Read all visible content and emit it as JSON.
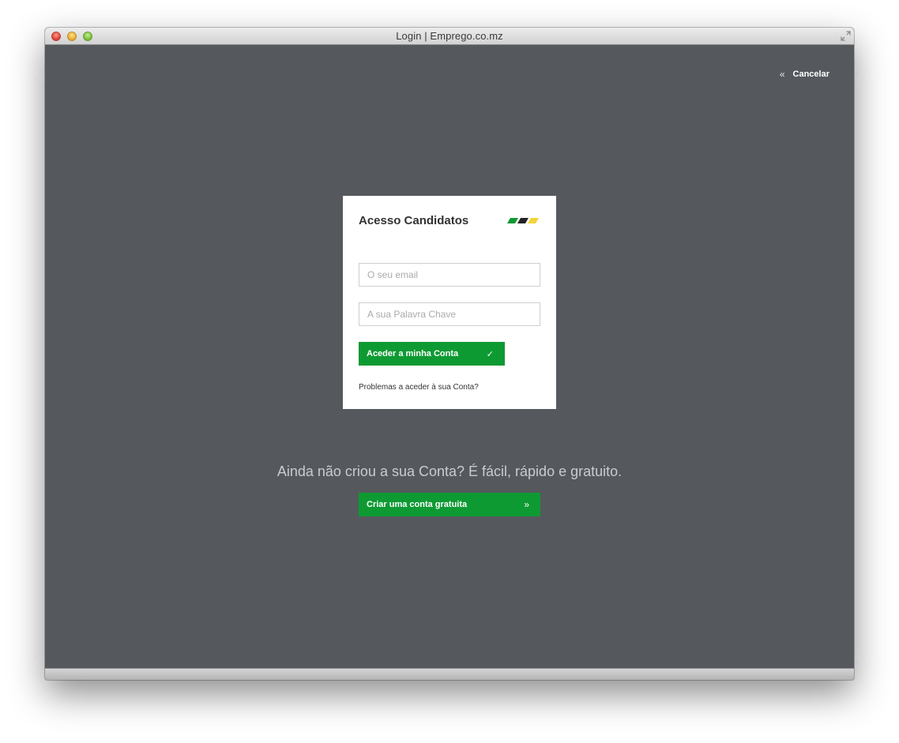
{
  "window": {
    "title": "Login | Emprego.co.mz"
  },
  "header": {
    "cancel_label": "Cancelar",
    "cancel_icon": "chevron-double-left-icon"
  },
  "login_card": {
    "title": "Acesso Candidatos",
    "email_placeholder": "O seu email",
    "password_placeholder": "A sua Palavra Chave",
    "submit_label": "Aceder a minha Conta",
    "submit_icon": "check-icon",
    "trouble_link": "Problemas a aceder à sua Conta?"
  },
  "signup": {
    "promo_text": "Ainda não criou a sua Conta? É fácil, rápido e gratuito.",
    "button_label": "Criar uma conta gratuita",
    "button_icon": "chevron-double-right-icon"
  },
  "colors": {
    "background": "#55595d",
    "accent_green": "#0e9a33",
    "logo_green": "#0e9a33",
    "logo_black": "#222222",
    "logo_yellow": "#f2d43a"
  }
}
